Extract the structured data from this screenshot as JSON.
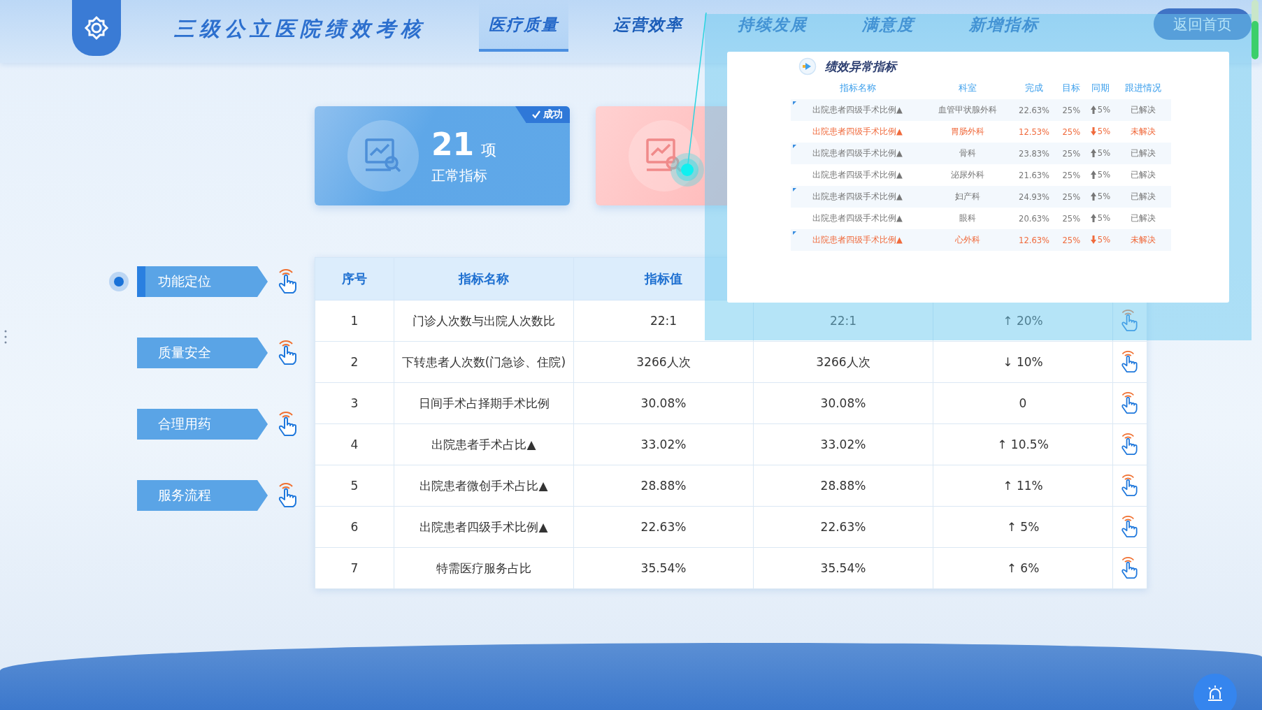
{
  "header": {
    "title": "三级公立医院绩效考核",
    "home_button": "返回首页",
    "tabs": [
      {
        "label": "医疗质量",
        "selected": true
      },
      {
        "label": "运营效率",
        "selected": false
      },
      {
        "label": "持续发展",
        "selected": false
      },
      {
        "label": "满意度",
        "selected": false
      },
      {
        "label": "新增指标",
        "selected": false
      }
    ]
  },
  "stat_cards": [
    {
      "kind": "normal",
      "count": "21",
      "unit": "项",
      "label": "正常指标",
      "badge": "成功"
    },
    {
      "kind": "abnormal"
    }
  ],
  "categories": [
    {
      "label": "功能定位",
      "selected": true
    },
    {
      "label": "质量安全",
      "selected": false
    },
    {
      "label": "合理用药",
      "selected": false
    },
    {
      "label": "服务流程",
      "selected": false
    }
  ],
  "table": {
    "columns": [
      "序号",
      "指标名称",
      "指标值"
    ],
    "rows": [
      {
        "cells": [
          "1",
          "门诊人次数与出院人次数比",
          "22:1",
          "22:1",
          "↑ 20%"
        ]
      },
      {
        "cells": [
          "2",
          "下转患者人次数(门急诊、住院)",
          "3266人次",
          "3266人次",
          "↓ 10%"
        ]
      },
      {
        "cells": [
          "3",
          "日间手术占择期手术比例",
          "30.08%",
          "30.08%",
          "0"
        ]
      },
      {
        "cells": [
          "4",
          "出院患者手术占比▲",
          "33.02%",
          "33.02%",
          "↑ 10.5%"
        ]
      },
      {
        "cells": [
          "5",
          "出院患者微创手术占比▲",
          "28.88%",
          "28.88%",
          "↑ 11%"
        ]
      },
      {
        "cells": [
          "6",
          "出院患者四级手术比例▲",
          "22.63%",
          "22.63%",
          "↑ 5%"
        ]
      },
      {
        "cells": [
          "7",
          "特需医疗服务占比",
          "35.54%",
          "35.54%",
          "↑ 6%"
        ]
      }
    ]
  },
  "popup": {
    "title": "绩效异常指标",
    "columns": [
      "指标名称",
      "科室",
      "完成",
      "目标",
      "同期",
      "跟进情况"
    ],
    "rows": [
      {
        "unresolved": false,
        "rising": true,
        "cells": [
          "出院患者四级手术比例▲",
          "血管甲状腺外科",
          "22.63%",
          "25%",
          "5%",
          "已解决"
        ]
      },
      {
        "unresolved": true,
        "rising": false,
        "cells": [
          "出院患者四级手术比例▲",
          "胃肠外科",
          "12.53%",
          "25%",
          "5%",
          "未解决"
        ]
      },
      {
        "unresolved": false,
        "rising": true,
        "cells": [
          "出院患者四级手术比例▲",
          "骨科",
          "23.83%",
          "25%",
          "5%",
          "已解决"
        ]
      },
      {
        "unresolved": false,
        "rising": true,
        "cells": [
          "出院患者四级手术比例▲",
          "泌尿外科",
          "21.63%",
          "25%",
          "5%",
          "已解决"
        ]
      },
      {
        "unresolved": false,
        "rising": true,
        "cells": [
          "出院患者四级手术比例▲",
          "妇产科",
          "24.93%",
          "25%",
          "5%",
          "已解决"
        ]
      },
      {
        "unresolved": false,
        "rising": true,
        "cells": [
          "出院患者四级手术比例▲",
          "眼科",
          "20.63%",
          "25%",
          "5%",
          "已解决"
        ]
      },
      {
        "unresolved": true,
        "rising": false,
        "cells": [
          "出院患者四级手术比例▲",
          "心外科",
          "12.63%",
          "25%",
          "5%",
          "未解决"
        ]
      }
    ]
  }
}
